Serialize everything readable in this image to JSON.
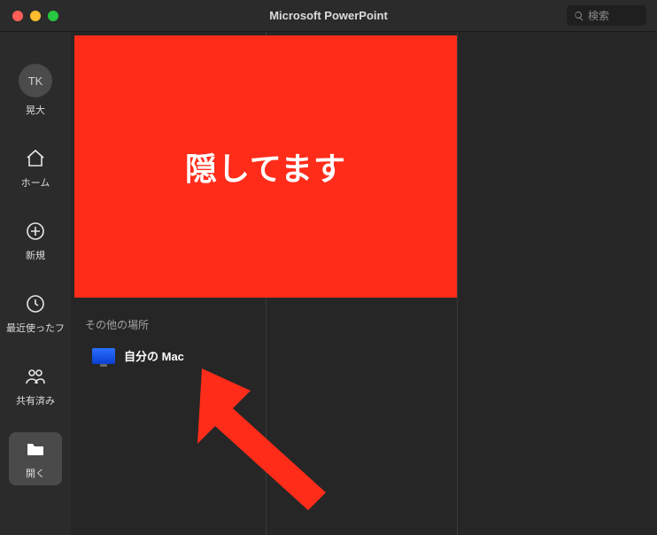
{
  "window": {
    "title": "Microsoft PowerPoint",
    "search_placeholder": "検索"
  },
  "sidebar": {
    "avatar_initials": "TK",
    "avatar_label": "晃大",
    "items": [
      {
        "label": "ホーム"
      },
      {
        "label": "新規"
      },
      {
        "label": "最近使ったフ"
      },
      {
        "label": "共有済み"
      },
      {
        "label": "開く"
      }
    ]
  },
  "main": {
    "red_block_text": "隠してます",
    "section_header": "その他の場所",
    "locations": [
      {
        "label": "自分の Mac"
      }
    ]
  }
}
